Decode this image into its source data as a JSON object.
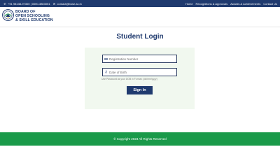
{
  "topbar": {
    "phone": "+91 98138-97300 | 0000-3803051",
    "email": "contact@bose.ac.in",
    "nav": [
      "Home",
      "Recognitions & Approvals",
      "Awards & Achievements",
      "Contact Us"
    ]
  },
  "header": {
    "org_name_line1": "BOARD OF",
    "org_name_line2": "OPEN SCHOOLING",
    "org_name_line3": "& SKILL EDUCATION"
  },
  "login": {
    "title": "Student Login",
    "registration_placeholder": "Registration Number",
    "dob_placeholder": "Date of Birth",
    "hint": "Use Password as your DOB in Format: (dd/mm/yyyy)",
    "signin_label": "Sign In"
  },
  "footer": {
    "copyright": "© Copyright 2023 All Rights Reserved"
  },
  "colors": {
    "primary": "#1f3a6e",
    "footer_green": "#1a9a4a",
    "card_bg": "#f1f8ef"
  }
}
